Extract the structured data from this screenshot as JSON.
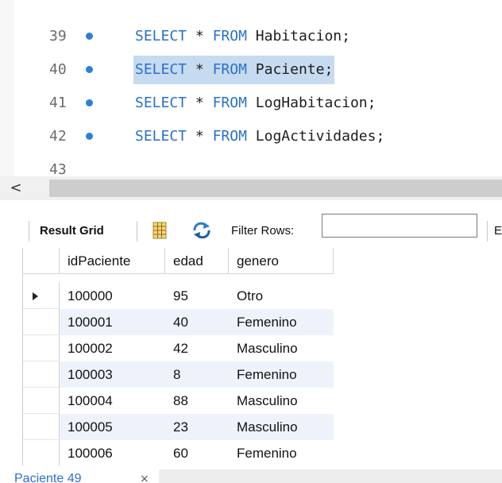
{
  "editor": {
    "lines": [
      {
        "num": "39",
        "kw1": "SELECT",
        "star": "*",
        "kw2": "FROM",
        "table": "Habitacion",
        "end": ";"
      },
      {
        "num": "40",
        "kw1": "SELECT",
        "star": "*",
        "kw2": "FROM",
        "table": "Paciente",
        "end": ";"
      },
      {
        "num": "41",
        "kw1": "SELECT",
        "star": "*",
        "kw2": "FROM",
        "table": "LogHabitacion",
        "end": ";"
      },
      {
        "num": "42",
        "kw1": "SELECT",
        "star": "*",
        "kw2": "FROM",
        "table": "LogActividades",
        "end": ";"
      },
      {
        "num": "43"
      }
    ],
    "selected_line": "40",
    "colors": {
      "keyword": "#2a70c9",
      "selection": "#c6dbf0",
      "exec_dot": "#2d7fd8"
    }
  },
  "scrollbar": {
    "left_arrow": "<"
  },
  "toolbar": {
    "result_grid_label": "Result Grid",
    "filter_rows_label": "Filter Rows:",
    "filter_rows_value": "",
    "trailing_label": "E",
    "icons": [
      "grid-layout-icon",
      "refresh-icon"
    ]
  },
  "grid": {
    "columns": [
      "idPaciente",
      "edad",
      "genero"
    ],
    "rows": [
      [
        "100000",
        "95",
        "Otro"
      ],
      [
        "100001",
        "40",
        "Femenino"
      ],
      [
        "100002",
        "42",
        "Masculino"
      ],
      [
        "100003",
        "8",
        "Femenino"
      ],
      [
        "100004",
        "88",
        "Masculino"
      ],
      [
        "100005",
        "23",
        "Masculino"
      ],
      [
        "100006",
        "60",
        "Femenino"
      ]
    ],
    "current_row_index": 0
  },
  "result_tab": {
    "label": "Paciente 49",
    "close": "×"
  }
}
